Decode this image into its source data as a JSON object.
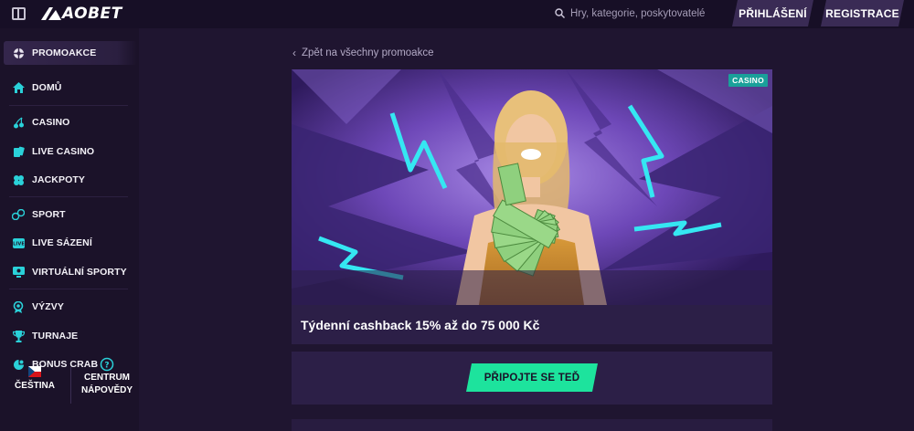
{
  "header": {
    "logo_text": "AOBET",
    "search_placeholder": "Hry, kategorie, poskytovatelé",
    "login_label": "PŘIHLÁŠENÍ",
    "register_label": "REGISTRACE"
  },
  "sidebar": {
    "items": [
      {
        "label": "PROMOAKCE",
        "icon": "gift-icon"
      },
      {
        "label": "DOMŮ",
        "icon": "home-icon"
      },
      {
        "label": "CASINO",
        "icon": "cherries-icon"
      },
      {
        "label": "LIVE CASINO",
        "icon": "cards-icon"
      },
      {
        "label": "JACKPOTY",
        "icon": "clover-icon"
      },
      {
        "label": "SPORT",
        "icon": "sports-icon"
      },
      {
        "label": "LIVE SÁZENÍ",
        "icon": "live-icon"
      },
      {
        "label": "VIRTUÁLNÍ SPORTY",
        "icon": "monitor-icon"
      },
      {
        "label": "VÝZVY",
        "icon": "medal-icon"
      },
      {
        "label": "TURNAJE",
        "icon": "trophy-icon"
      },
      {
        "label": "BONUS CRAB",
        "icon": "crab-icon"
      }
    ],
    "language_label": "ČEŠTINA",
    "help_line1": "CENTRUM",
    "help_line2": "NÁPOVĚDY"
  },
  "main": {
    "back_label": "Zpět na všechny promoakce",
    "badge": "CASINO",
    "promo_title": "Týdenní cashback 15% až do 75 000 Kč",
    "cta_label": "PŘIPOJTE SE TEĎ"
  },
  "colors": {
    "accent": "#1de39d",
    "badge": "#1aa09a",
    "background": "#1f1530",
    "card": "#2c1f47"
  }
}
